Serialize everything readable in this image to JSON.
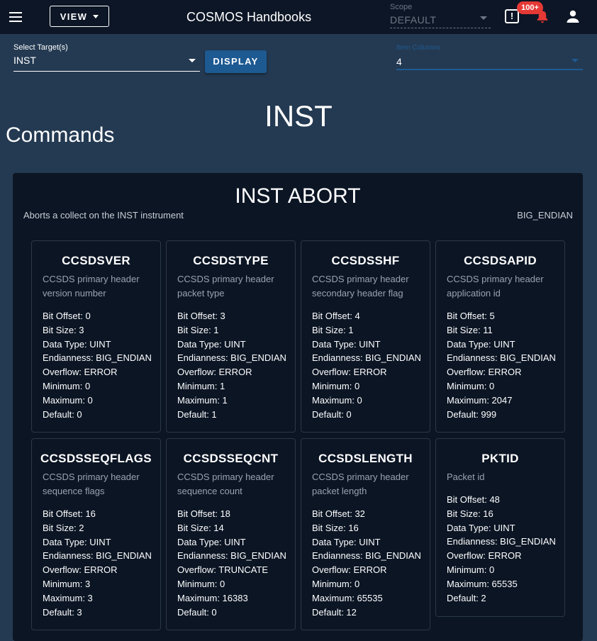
{
  "appbar": {
    "view_label": "VIEW",
    "title": "COSMOS Handbooks",
    "scope_label": "Scope",
    "scope_value": "DEFAULT",
    "alert_icon": "!",
    "notification_badge": "100+"
  },
  "controls": {
    "target_label": "Select Target(s)",
    "target_value": "INST",
    "display_label": "DISPLAY",
    "columns_label": "Item Columns",
    "columns_value": "4"
  },
  "page": {
    "heading": "INST",
    "section": "Commands"
  },
  "packet": {
    "title": "INST ABORT",
    "description": "Aborts a collect on the INST instrument",
    "endianness": "BIG_ENDIAN",
    "items": [
      {
        "name": "CCSDSVER",
        "desc": [
          "CCSDS primary header",
          "version number"
        ],
        "props": [
          "Bit Offset: 0",
          "Bit Size: 3",
          "Data Type: UINT",
          "Endianness: BIG_ENDIAN",
          "Overflow: ERROR",
          "Minimum: 0",
          "Maximum: 0",
          "Default: 0"
        ]
      },
      {
        "name": "CCSDSTYPE",
        "desc": [
          "CCSDS primary header",
          "packet type"
        ],
        "props": [
          "Bit Offset: 3",
          "Bit Size: 1",
          "Data Type: UINT",
          "Endianness: BIG_ENDIAN",
          "Overflow: ERROR",
          "Minimum: 1",
          "Maximum: 1",
          "Default: 1"
        ]
      },
      {
        "name": "CCSDSSHF",
        "desc": [
          "CCSDS primary header",
          "secondary header flag"
        ],
        "props": [
          "Bit Offset: 4",
          "Bit Size: 1",
          "Data Type: UINT",
          "Endianness: BIG_ENDIAN",
          "Overflow: ERROR",
          "Minimum: 0",
          "Maximum: 0",
          "Default: 0"
        ]
      },
      {
        "name": "CCSDSAPID",
        "desc": [
          "CCSDS primary header",
          "application id"
        ],
        "props": [
          "Bit Offset: 5",
          "Bit Size: 11",
          "Data Type: UINT",
          "Endianness: BIG_ENDIAN",
          "Overflow: ERROR",
          "Minimum: 0",
          "Maximum: 2047",
          "Default: 999"
        ]
      },
      {
        "name": "CCSDSSEQFLAGS",
        "desc": [
          "CCSDS primary header",
          "sequence flags"
        ],
        "props": [
          "Bit Offset: 16",
          "Bit Size: 2",
          "Data Type: UINT",
          "Endianness: BIG_ENDIAN",
          "Overflow: ERROR",
          "Minimum: 3",
          "Maximum: 3",
          "Default: 3"
        ]
      },
      {
        "name": "CCSDSSEQCNT",
        "desc": [
          "CCSDS primary header",
          "sequence count"
        ],
        "props": [
          "Bit Offset: 18",
          "Bit Size: 14",
          "Data Type: UINT",
          "Endianness: BIG_ENDIAN",
          "Overflow: TRUNCATE",
          "Minimum: 0",
          "Maximum: 16383",
          "Default: 0"
        ]
      },
      {
        "name": "CCSDSLENGTH",
        "desc": [
          "CCSDS primary header",
          "packet length"
        ],
        "props": [
          "Bit Offset: 32",
          "Bit Size: 16",
          "Data Type: UINT",
          "Endianness: BIG_ENDIAN",
          "Overflow: ERROR",
          "Minimum: 0",
          "Maximum: 65535",
          "Default: 12"
        ]
      },
      {
        "name": "PKTID",
        "desc": [
          "Packet id"
        ],
        "props": [
          "Bit Offset: 48",
          "Bit Size: 16",
          "Data Type: UINT",
          "Endianness: BIG_ENDIAN",
          "Overflow: ERROR",
          "Minimum: 0",
          "Maximum: 65535",
          "Default: 2"
        ]
      }
    ]
  }
}
